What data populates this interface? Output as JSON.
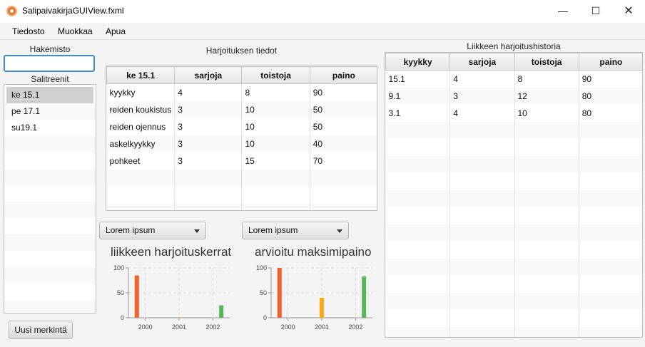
{
  "window": {
    "title": "SalipaivakirjaGUIView.fxml",
    "minimize": "—",
    "maximize": "☐",
    "close": "✕"
  },
  "menu": {
    "items": [
      "Tiedosto",
      "Muokkaa",
      "Apua"
    ]
  },
  "left": {
    "directory_label": "Hakemisto",
    "search_value": "",
    "workouts_label": "Salitreenit",
    "workouts": [
      "ke 15.1",
      "pe 17.1",
      "su19.1"
    ],
    "selected_index": 0,
    "new_button": "Uusi merkintä"
  },
  "workout": {
    "title": "Harjoituksen tiedot",
    "columns": [
      "ke 15.1",
      "sarjoja",
      "toistoja",
      "paino"
    ],
    "rows": [
      [
        "kyykky",
        "4",
        "8",
        "90"
      ],
      [
        "reiden koukistus",
        "3",
        "10",
        "50"
      ],
      [
        "reiden ojennus",
        "3",
        "10",
        "50"
      ],
      [
        "askelkyykky",
        "3",
        "10",
        "40"
      ],
      [
        "pohkeet",
        "3",
        "15",
        "70"
      ]
    ],
    "empty_rows": 3
  },
  "history": {
    "title": "Liikkeen harjoitushistoria",
    "columns": [
      "kyykky",
      "sarjoja",
      "toistoja",
      "paino"
    ],
    "rows": [
      [
        "15.1",
        "4",
        "8",
        "90"
      ],
      [
        "9.1",
        "3",
        "12",
        "80"
      ],
      [
        "3.1",
        "4",
        "10",
        "80"
      ]
    ],
    "empty_rows": 13
  },
  "combos": {
    "left_value": "Lorem ipsum",
    "right_value": "Lorem ipsum"
  },
  "colors": {
    "series1": "#f3622d",
    "series2": "#fba71b",
    "series3": "#57b757",
    "accent": "#3b8ed6"
  },
  "chart_data": [
    {
      "type": "bar",
      "title": "liikkeen harjoituskerrat",
      "categories": [
        "2000",
        "2001",
        "2002"
      ],
      "series": [
        {
          "values": [
            85,
            0,
            0
          ]
        },
        {
          "values": [
            0,
            1,
            0
          ]
        },
        {
          "values": [
            0,
            0,
            25
          ]
        }
      ],
      "ylim": [
        0,
        100
      ],
      "yticks": [
        0,
        50,
        100
      ],
      "grid": true,
      "legend": "none"
    },
    {
      "type": "bar",
      "title": "arvioitu maksimipaino",
      "categories": [
        "2000",
        "2001",
        "2002"
      ],
      "series": [
        {
          "values": [
            100,
            0,
            0
          ]
        },
        {
          "values": [
            0,
            40,
            0
          ]
        },
        {
          "values": [
            0,
            0,
            83
          ]
        }
      ],
      "ylim": [
        0,
        100
      ],
      "yticks": [
        0,
        50,
        100
      ],
      "grid": true,
      "legend": "none"
    }
  ]
}
